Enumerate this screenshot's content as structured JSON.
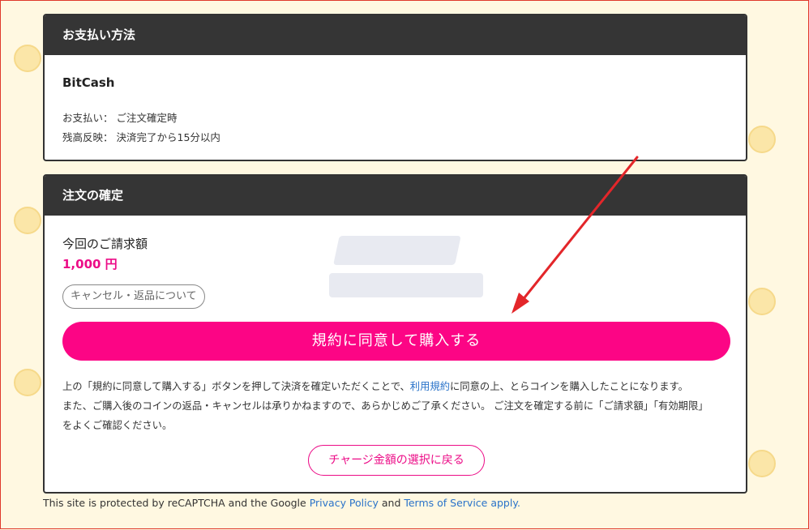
{
  "payment_section": {
    "title": "お支払い方法",
    "method": "BitCash",
    "payment_label": "お支払い：",
    "payment_value": "ご注文確定時",
    "balance_label": "残高反映：",
    "balance_value": "決済完了から15分以内"
  },
  "confirm_section": {
    "title": "注文の確定",
    "amount_label": "今回のご請求額",
    "amount_value": "1,000 円",
    "cancel_link": "キャンセル・返品について",
    "agree_button": "規約に同意して購入する",
    "notice_part1": "上の「規約に同意して購入する」ボタンを押して決済を確定いただくことで、",
    "terms_link": "利用規約",
    "notice_part2": "に同意の上、とらコインを購入したことになります。",
    "notice_line2": "また、ご購入後のコインの返品・キャンセルは承りかねますので、あらかじめご了承ください。 ご注文を確定する前に「ご請求額」「有効期限」",
    "notice_line3": "をよくご確認ください。",
    "back_button": "チャージ金額の選択に戻る"
  },
  "footer": {
    "text1": "This site is protected by reCAPTCHA and the Google ",
    "privacy_link": "Privacy Policy",
    "text2": " and ",
    "terms_link": "Terms of Service apply."
  },
  "colors": {
    "accent": "#fc0585",
    "header_bg": "#353535",
    "link": "#2a73c9",
    "page_bg": "#fff8e1",
    "arrow": "#e3262a"
  }
}
